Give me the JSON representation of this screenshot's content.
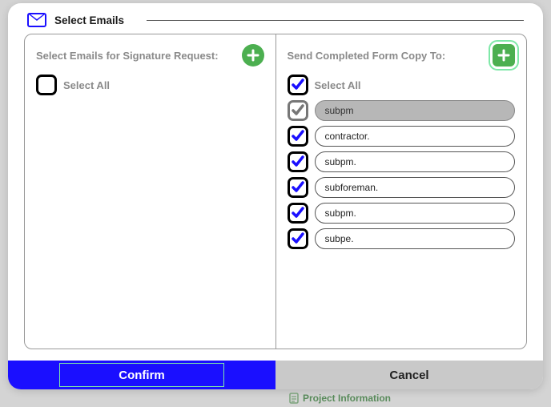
{
  "header": {
    "title": "Select Emails"
  },
  "left_panel": {
    "title": "Select Emails for Signature Request:",
    "select_all_label": "Select All",
    "select_all_checked": false
  },
  "right_panel": {
    "title": "Send Completed Form Copy To:",
    "select_all_label": "Select All",
    "select_all_checked": true,
    "items": [
      {
        "label": "subpm",
        "checked": true,
        "style": "grey"
      },
      {
        "label": "contractor.",
        "checked": true,
        "style": "normal"
      },
      {
        "label": "subpm.",
        "checked": true,
        "style": "normal"
      },
      {
        "label": "subforeman.",
        "checked": true,
        "style": "normal"
      },
      {
        "label": "subpm.",
        "checked": true,
        "style": "normal"
      },
      {
        "label": "subpe.",
        "checked": true,
        "style": "normal"
      }
    ]
  },
  "footer": {
    "confirm": "Confirm",
    "cancel": "Cancel"
  },
  "behind": {
    "project_info": "Project Information"
  }
}
